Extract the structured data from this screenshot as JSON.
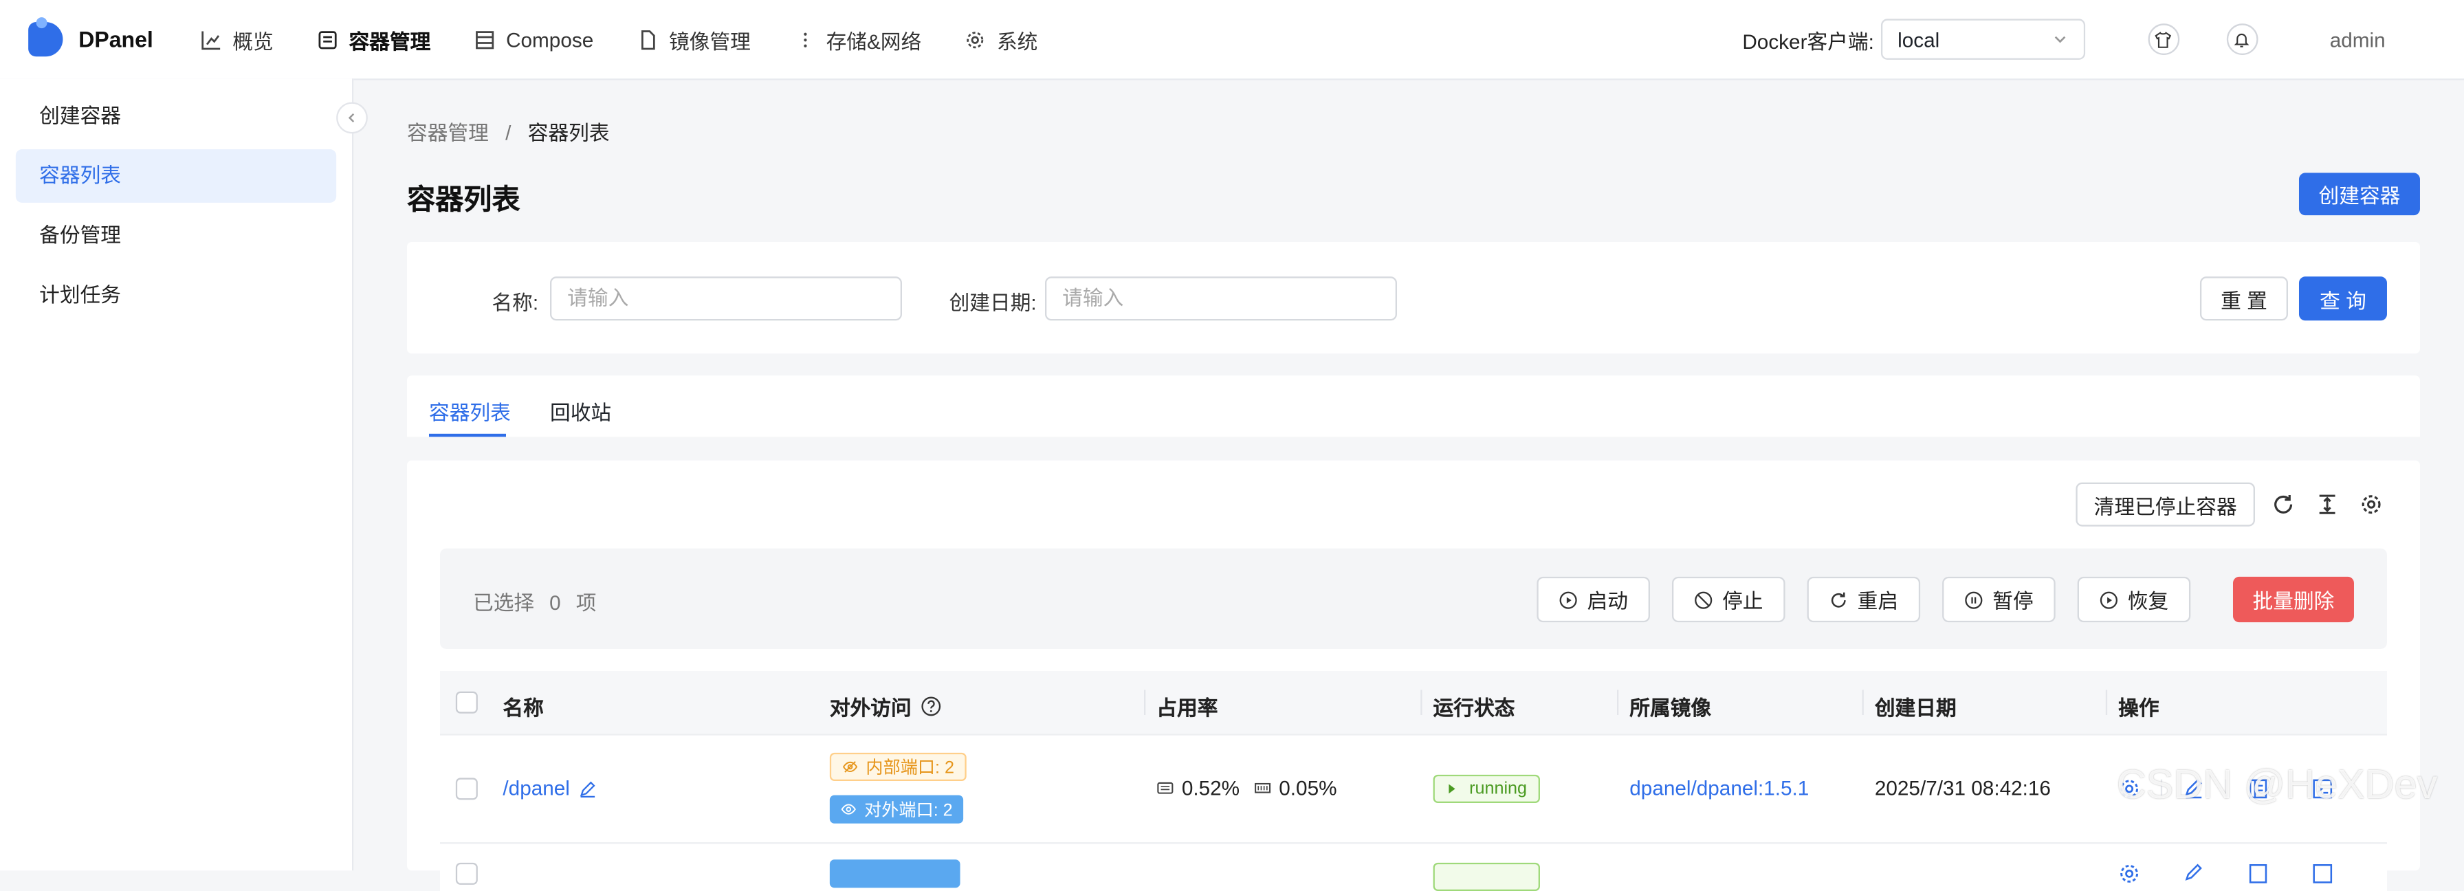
{
  "app": {
    "name": "DPanel"
  },
  "nav": [
    {
      "label": "概览",
      "icon": "chart-icon"
    },
    {
      "label": "容器管理",
      "icon": "container-icon"
    },
    {
      "label": "Compose",
      "icon": "compose-icon"
    },
    {
      "label": "镜像管理",
      "icon": "file-icon"
    },
    {
      "label": "存储&网络",
      "icon": "more-vertical-icon"
    },
    {
      "label": "系统",
      "icon": "gear-icon"
    }
  ],
  "header": {
    "docker_label": "Docker客户端:",
    "docker_value": "local",
    "user": "admin"
  },
  "sidebar": [
    {
      "label": "创建容器"
    },
    {
      "label": "容器列表"
    },
    {
      "label": "备份管理"
    },
    {
      "label": "计划任务"
    }
  ],
  "breadcrumb": {
    "parent": "容器管理",
    "sep": "/",
    "current": "容器列表"
  },
  "page": {
    "title": "容器列表",
    "create_button": "创建容器"
  },
  "filters": {
    "name_label": "名称:",
    "name_placeholder": "请输入",
    "date_label": "创建日期:",
    "date_placeholder": "请输入",
    "reset": "重 置",
    "query": "查 询"
  },
  "tabs": [
    {
      "label": "容器列表"
    },
    {
      "label": "回收站"
    }
  ],
  "toolbar": {
    "clean_stopped": "清理已停止容器"
  },
  "batch": {
    "selected_prefix": "已选择",
    "selected_count": "0",
    "selected_suffix": "项",
    "start": "启动",
    "stop": "停止",
    "restart": "重启",
    "pause": "暂停",
    "resume": "恢复",
    "delete": "批量删除"
  },
  "table": {
    "columns": [
      "名称",
      "对外访问",
      "占用率",
      "运行状态",
      "所属镜像",
      "创建日期",
      "操作"
    ],
    "rows": [
      {
        "name": "/dpanel",
        "internal_ports": "内部端口: 2",
        "external_ports": "对外端口: 2",
        "cpu": "0.52%",
        "mem": "0.05%",
        "status": "running",
        "image": "dpanel/dpanel:1.5.1",
        "created": "2025/7/31 08:42:16"
      }
    ]
  },
  "watermark": "CSDN @HeXDev",
  "colors": {
    "primary": "#2f6ee8",
    "danger": "#ee5a5a",
    "running": "#4a9a21"
  }
}
